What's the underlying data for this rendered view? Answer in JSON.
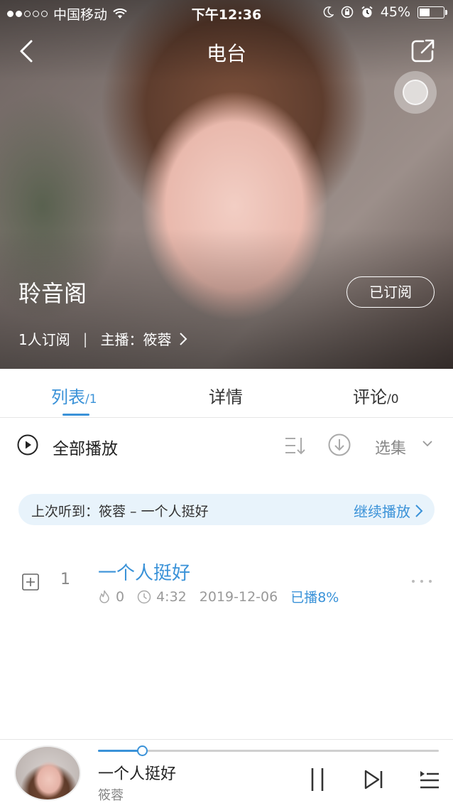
{
  "status_bar": {
    "carrier": "中国移动",
    "time": "下午12:36",
    "battery": "45%",
    "battery_level": 0.45
  },
  "nav": {
    "title": "电台"
  },
  "radio": {
    "name": "聆音阁",
    "subscribe_label": "已订阅",
    "subscribers": "1人订阅",
    "host_label": "主播：筱蓉"
  },
  "tabs": [
    {
      "label": "列表",
      "count": "/1"
    },
    {
      "label": "详情",
      "count": ""
    },
    {
      "label": "评论",
      "count": "/0"
    }
  ],
  "toolbar": {
    "play_all": "全部播放",
    "select_episodes": "选集"
  },
  "resume": {
    "label": "上次听到：筱蓉 – 一个人挺好",
    "action": "继续播放"
  },
  "tracks": [
    {
      "index": "1",
      "title": "一个人挺好",
      "plays": "0",
      "duration": "4:32",
      "date": "2019-12-06",
      "played": "已播8%"
    }
  ],
  "player": {
    "song": "一个人挺好",
    "artist": "筱蓉",
    "progress": 0.13
  },
  "colors": {
    "accent": "#3a92d8",
    "resume_bg": "#e8f3fb"
  }
}
